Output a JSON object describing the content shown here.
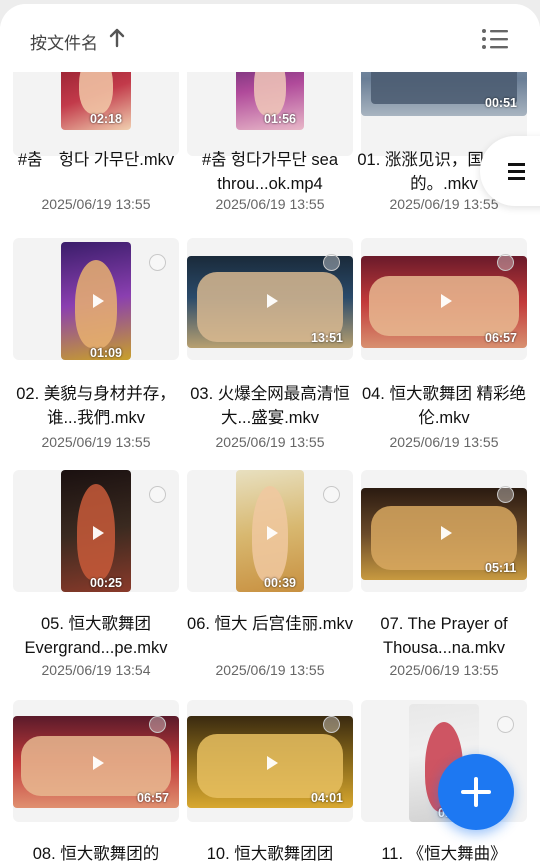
{
  "header": {
    "sort_label": "按文件名",
    "sort_icon": "arrow-up-icon",
    "view_toggle_icon": "list-view-icon"
  },
  "colors": {
    "accent": "#1d78f2",
    "text": "#111111",
    "meta": "#666666"
  },
  "videos": [
    {
      "title": "#춤　헝다 가무단.mkv",
      "date": "2025/06/19 13:55",
      "duration": "02:18"
    },
    {
      "title": "#춤 헝다가무단 sea throu...ok.mp4",
      "date": "2025/06/19 13:55",
      "duration": "01:56"
    },
    {
      "title": "01. 涨涨见识，国内恒...的。.mkv",
      "date": "2025/06/19 13:55",
      "duration": "00:51"
    },
    {
      "title": "02. 美貌与身材并存，谁...我們.mkv",
      "date": "2025/06/19 13:55",
      "duration": "01:09"
    },
    {
      "title": "03. 火爆全网最高清恒大...盛宴.mkv",
      "date": "2025/06/19 13:55",
      "duration": "13:51"
    },
    {
      "title": "04. 恒大歌舞团 精彩绝伦.mkv",
      "date": "2025/06/19 13:55",
      "duration": "06:57"
    },
    {
      "title": "05. 恒大歌舞团 Evergrand...pe.mkv",
      "date": "2025/06/19 13:54",
      "duration": "00:25"
    },
    {
      "title": "06. 恒大 后宫佳丽.mkv",
      "date": "2025/06/19 13:55",
      "duration": "00:39"
    },
    {
      "title": "07. The Prayer of Thousa...na.mkv",
      "date": "2025/06/19 13:55",
      "duration": "05:11"
    },
    {
      "title": "08. 恒大歌舞团的",
      "date": "",
      "duration": "06:57"
    },
    {
      "title": "10. 恒大歌舞团团",
      "date": "",
      "duration": "04:01"
    },
    {
      "title": "11. 《恒大舞曲》",
      "date": "",
      "duration": "01:"
    }
  ],
  "side_handle_icon": "menu-icon",
  "fab_icon": "plus-icon"
}
